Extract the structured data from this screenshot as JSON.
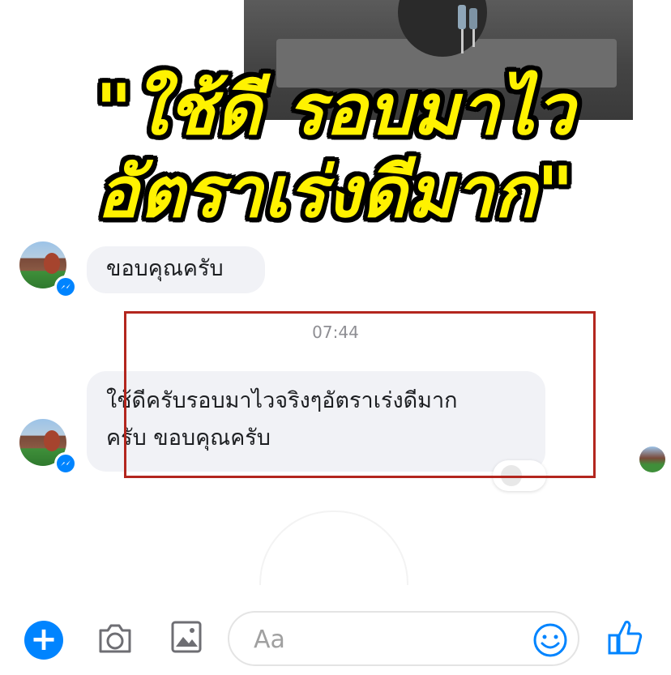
{
  "headline": {
    "line1": "\"ใช้ดี รอบมาไว",
    "line2": "อัตราเร่งดีมาก\""
  },
  "messages": [
    {
      "text": "ขอบคุณครับ"
    },
    {
      "time": "07:44"
    },
    {
      "text_line1": "ใช้ดีครับรอบมาไวจริงๆอัตราเร่งดีมาก",
      "text_line2": "ครับ ขอบคุณครับ"
    }
  ],
  "composer": {
    "placeholder": "Aa"
  },
  "icons": {
    "add": "plus-icon",
    "camera": "camera-icon",
    "gallery": "image-icon",
    "emoji": "smiley-icon",
    "like": "thumbs-up-icon",
    "badge": "messenger-icon"
  },
  "colors": {
    "accent": "#0084ff",
    "headline": "#fff200",
    "highlight_box": "#b3261e",
    "bubble": "#f1f2f6"
  }
}
